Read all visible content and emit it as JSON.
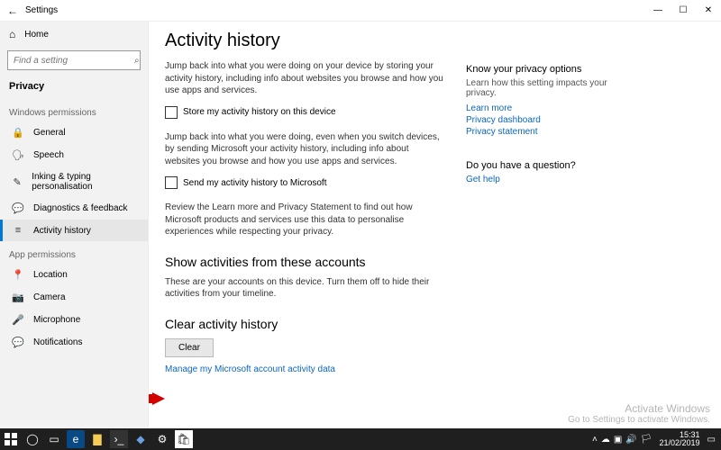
{
  "window": {
    "title": "Settings",
    "minimize": "—",
    "maximize": "☐",
    "close": "✕",
    "back": "←"
  },
  "sidebar": {
    "home": "Home",
    "search_placeholder": "Find a setting",
    "category": "Privacy",
    "group_windows": "Windows permissions",
    "group_app": "App permissions",
    "items_win": [
      {
        "icon": "🔒",
        "label": "General"
      },
      {
        "icon": "🗣",
        "label": "Speech"
      },
      {
        "icon": "✎",
        "label": "Inking & typing personalisation"
      },
      {
        "icon": "💬",
        "label": "Diagnostics & feedback"
      },
      {
        "icon": "≡",
        "label": "Activity history"
      }
    ],
    "items_app": [
      {
        "icon": "📍",
        "label": "Location"
      },
      {
        "icon": "📷",
        "label": "Camera"
      },
      {
        "icon": "🎤",
        "label": "Microphone"
      },
      {
        "icon": "💬",
        "label": "Notifications"
      }
    ]
  },
  "main": {
    "title": "Activity history",
    "p1": "Jump back into what you were doing on your device by storing your activity history, including info about websites you browse and how you use apps and services.",
    "chk1": "Store my activity history on this device",
    "p2": "Jump back into what you were doing, even when you switch devices, by sending Microsoft your activity history, including info about websites you browse and how you use apps and services.",
    "chk2": "Send my activity history to Microsoft",
    "p3": "Review the Learn more and Privacy Statement to find out how Microsoft products and services use this data to personalise experiences while respecting your privacy.",
    "h2a": "Show activities from these accounts",
    "p4": "These are your accounts on this device. Turn them off to hide their activities from your timeline.",
    "h2b": "Clear activity history",
    "clear": "Clear",
    "link_manage": "Manage my Microsoft account activity data"
  },
  "right": {
    "h1": "Know your privacy options",
    "t1": "Learn how this setting impacts your privacy.",
    "l1": "Learn more",
    "l2": "Privacy dashboard",
    "l3": "Privacy statement",
    "h2": "Do you have a question?",
    "l4": "Get help"
  },
  "watermark": {
    "t": "Activate Windows",
    "s": "Go to Settings to activate Windows."
  },
  "taskbar": {
    "time": "15:31",
    "date": "21/02/2019"
  }
}
